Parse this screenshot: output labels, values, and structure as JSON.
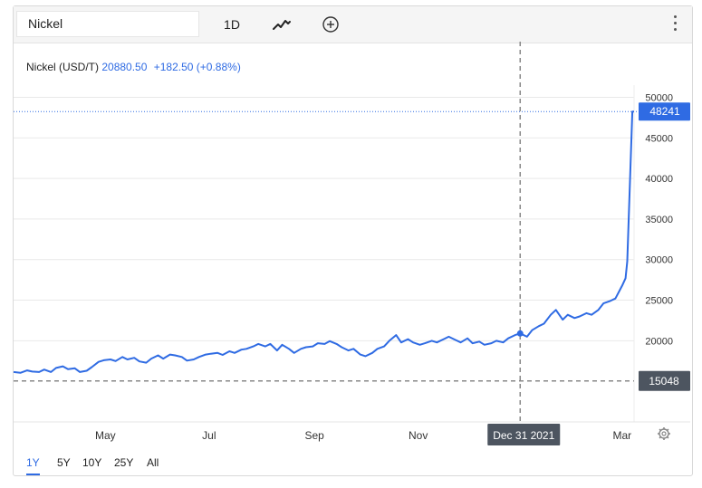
{
  "toolbar": {
    "symbol": "Nickel",
    "interval": "1D"
  },
  "legend": {
    "name": "Nickel (USD/T)",
    "last": "20880.50",
    "change": "+182.50 (+0.88%)"
  },
  "range_buttons": [
    "1Y",
    "5Y",
    "10Y",
    "25Y",
    "All"
  ],
  "active_range": "1Y",
  "colors": {
    "line": "#2f6be3",
    "price_tag": "#2f6be3",
    "crosshair_tag": "#4d5560"
  },
  "chart_data": {
    "type": "line",
    "title": "Nickel (USD/T)",
    "x_start": "2021-03-08",
    "x_end": "2022-03-08",
    "x_ticks": [
      {
        "date": "2021-05-01",
        "label": "May"
      },
      {
        "date": "2021-07-01",
        "label": "Jul"
      },
      {
        "date": "2021-09-01",
        "label": "Sep"
      },
      {
        "date": "2021-11-01",
        "label": "Nov"
      },
      {
        "date": "2022-03-01",
        "label": "Mar"
      }
    ],
    "y_ticks": [
      20000,
      25000,
      30000,
      35000,
      40000,
      45000,
      50000
    ],
    "ylim": [
      10000,
      51500
    ],
    "grid": true,
    "last_price_tag": 48241,
    "crosshair": {
      "date": "2021-12-31",
      "label": "Dec 31 2021",
      "price": 15048
    },
    "series": [
      {
        "name": "Nickel (USD/T)",
        "points": [
          [
            "2021-03-08",
            16150
          ],
          [
            "2021-03-12",
            16050
          ],
          [
            "2021-03-16",
            16350
          ],
          [
            "2021-03-19",
            16200
          ],
          [
            "2021-03-23",
            16150
          ],
          [
            "2021-03-26",
            16450
          ],
          [
            "2021-03-30",
            16150
          ],
          [
            "2021-04-02",
            16650
          ],
          [
            "2021-04-06",
            16850
          ],
          [
            "2021-04-09",
            16500
          ],
          [
            "2021-04-13",
            16600
          ],
          [
            "2021-04-16",
            16150
          ],
          [
            "2021-04-20",
            16300
          ],
          [
            "2021-04-23",
            16750
          ],
          [
            "2021-04-27",
            17400
          ],
          [
            "2021-04-30",
            17600
          ],
          [
            "2021-05-04",
            17700
          ],
          [
            "2021-05-07",
            17500
          ],
          [
            "2021-05-11",
            18000
          ],
          [
            "2021-05-14",
            17700
          ],
          [
            "2021-05-18",
            17900
          ],
          [
            "2021-05-21",
            17450
          ],
          [
            "2021-05-25",
            17300
          ],
          [
            "2021-05-28",
            17800
          ],
          [
            "2021-06-01",
            18200
          ],
          [
            "2021-06-04",
            17800
          ],
          [
            "2021-06-08",
            18300
          ],
          [
            "2021-06-11",
            18200
          ],
          [
            "2021-06-15",
            18000
          ],
          [
            "2021-06-18",
            17550
          ],
          [
            "2021-06-22",
            17700
          ],
          [
            "2021-06-25",
            18000
          ],
          [
            "2021-06-29",
            18300
          ],
          [
            "2021-07-02",
            18400
          ],
          [
            "2021-07-06",
            18500
          ],
          [
            "2021-07-09",
            18250
          ],
          [
            "2021-07-13",
            18700
          ],
          [
            "2021-07-16",
            18500
          ],
          [
            "2021-07-20",
            18900
          ],
          [
            "2021-07-23",
            19000
          ],
          [
            "2021-07-27",
            19300
          ],
          [
            "2021-07-30",
            19600
          ],
          [
            "2021-08-03",
            19300
          ],
          [
            "2021-08-06",
            19600
          ],
          [
            "2021-08-10",
            18800
          ],
          [
            "2021-08-13",
            19500
          ],
          [
            "2021-08-17",
            19000
          ],
          [
            "2021-08-20",
            18500
          ],
          [
            "2021-08-24",
            19000
          ],
          [
            "2021-08-27",
            19200
          ],
          [
            "2021-08-31",
            19300
          ],
          [
            "2021-09-03",
            19700
          ],
          [
            "2021-09-07",
            19600
          ],
          [
            "2021-09-10",
            19950
          ],
          [
            "2021-09-14",
            19600
          ],
          [
            "2021-09-17",
            19200
          ],
          [
            "2021-09-21",
            18800
          ],
          [
            "2021-09-24",
            19000
          ],
          [
            "2021-09-28",
            18300
          ],
          [
            "2021-10-01",
            18100
          ],
          [
            "2021-10-05",
            18500
          ],
          [
            "2021-10-08",
            19000
          ],
          [
            "2021-10-12",
            19300
          ],
          [
            "2021-10-15",
            20000
          ],
          [
            "2021-10-19",
            20700
          ],
          [
            "2021-10-22",
            19800
          ],
          [
            "2021-10-26",
            20200
          ],
          [
            "2021-10-29",
            19800
          ],
          [
            "2021-11-02",
            19500
          ],
          [
            "2021-11-05",
            19700
          ],
          [
            "2021-11-09",
            20000
          ],
          [
            "2021-11-12",
            19800
          ],
          [
            "2021-11-16",
            20200
          ],
          [
            "2021-11-19",
            20500
          ],
          [
            "2021-11-23",
            20100
          ],
          [
            "2021-11-26",
            19800
          ],
          [
            "2021-11-30",
            20300
          ],
          [
            "2021-12-03",
            19700
          ],
          [
            "2021-12-07",
            19900
          ],
          [
            "2021-12-10",
            19500
          ],
          [
            "2021-12-14",
            19700
          ],
          [
            "2021-12-17",
            20000
          ],
          [
            "2021-12-21",
            19800
          ],
          [
            "2021-12-24",
            20300
          ],
          [
            "2021-12-28",
            20700
          ],
          [
            "2021-12-31",
            20900
          ],
          [
            "2022-01-04",
            20500
          ],
          [
            "2022-01-07",
            21300
          ],
          [
            "2022-01-11",
            21800
          ],
          [
            "2022-01-14",
            22100
          ],
          [
            "2022-01-18",
            23200
          ],
          [
            "2022-01-21",
            23800
          ],
          [
            "2022-01-25",
            22600
          ],
          [
            "2022-01-28",
            23200
          ],
          [
            "2022-02-01",
            22800
          ],
          [
            "2022-02-04",
            23000
          ],
          [
            "2022-02-08",
            23400
          ],
          [
            "2022-02-11",
            23200
          ],
          [
            "2022-02-15",
            23800
          ],
          [
            "2022-02-18",
            24600
          ],
          [
            "2022-02-22",
            24900
          ],
          [
            "2022-02-25",
            25200
          ],
          [
            "2022-03-01",
            26800
          ],
          [
            "2022-03-03",
            27700
          ],
          [
            "2022-03-04",
            29800
          ],
          [
            "2022-03-07",
            48241
          ],
          [
            "2022-03-08",
            48241
          ]
        ]
      }
    ]
  }
}
